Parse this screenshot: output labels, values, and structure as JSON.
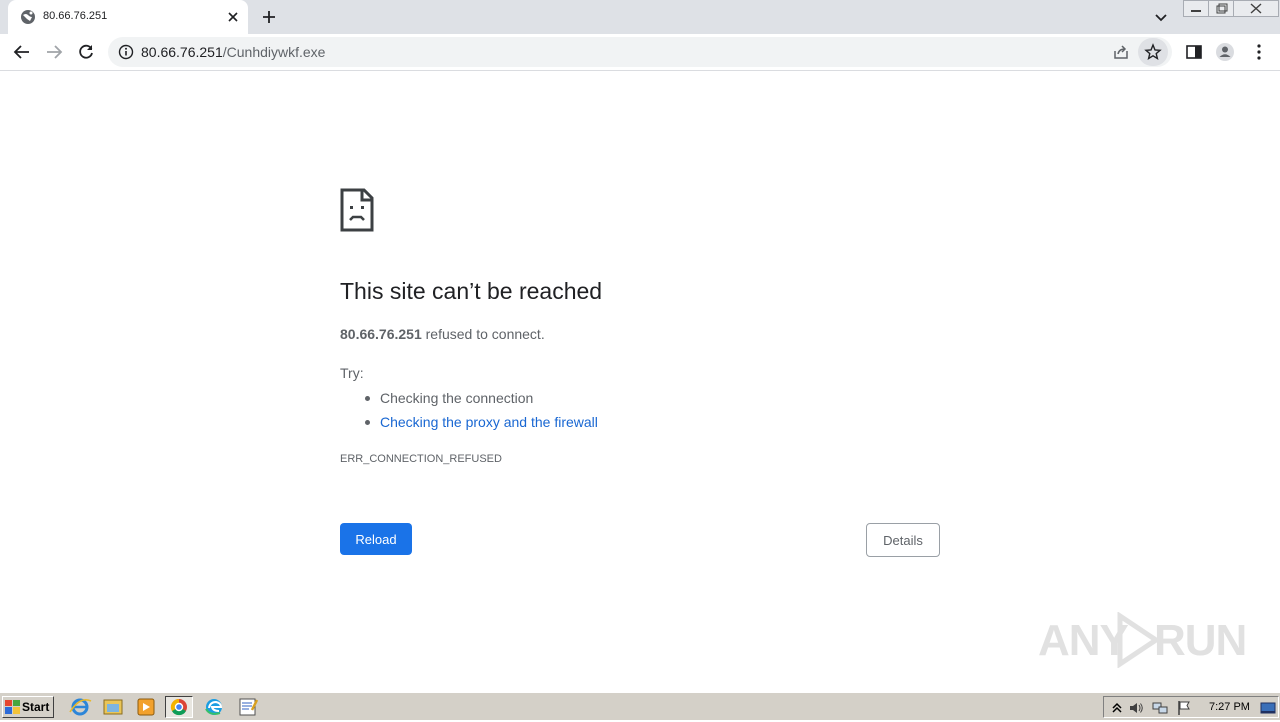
{
  "tab": {
    "title": "80.66.76.251"
  },
  "omnibox": {
    "url_host": "80.66.76.251",
    "url_path": "/Cunhdiywkf.exe"
  },
  "error_page": {
    "title": "This site can’t be reached",
    "host": "80.66.76.251",
    "description": " refused to connect.",
    "try_label": "Try:",
    "suggestions": [
      "Checking the connection",
      "Checking the proxy and the firewall"
    ],
    "error_code": "ERR_CONNECTION_REFUSED",
    "reload_label": "Reload",
    "details_label": "Details"
  },
  "watermark": {
    "left": "ANY",
    "right": "RUN"
  },
  "taskbar": {
    "start_label": "Start",
    "clock": "7:27 PM"
  },
  "colors": {
    "accent_blue": "#1a73e8",
    "link_blue": "#1967d2",
    "tabstrip_bg": "#dee1e6",
    "omnibox_bg": "#f1f3f4",
    "taskbar_bg": "#d4d0c8"
  }
}
